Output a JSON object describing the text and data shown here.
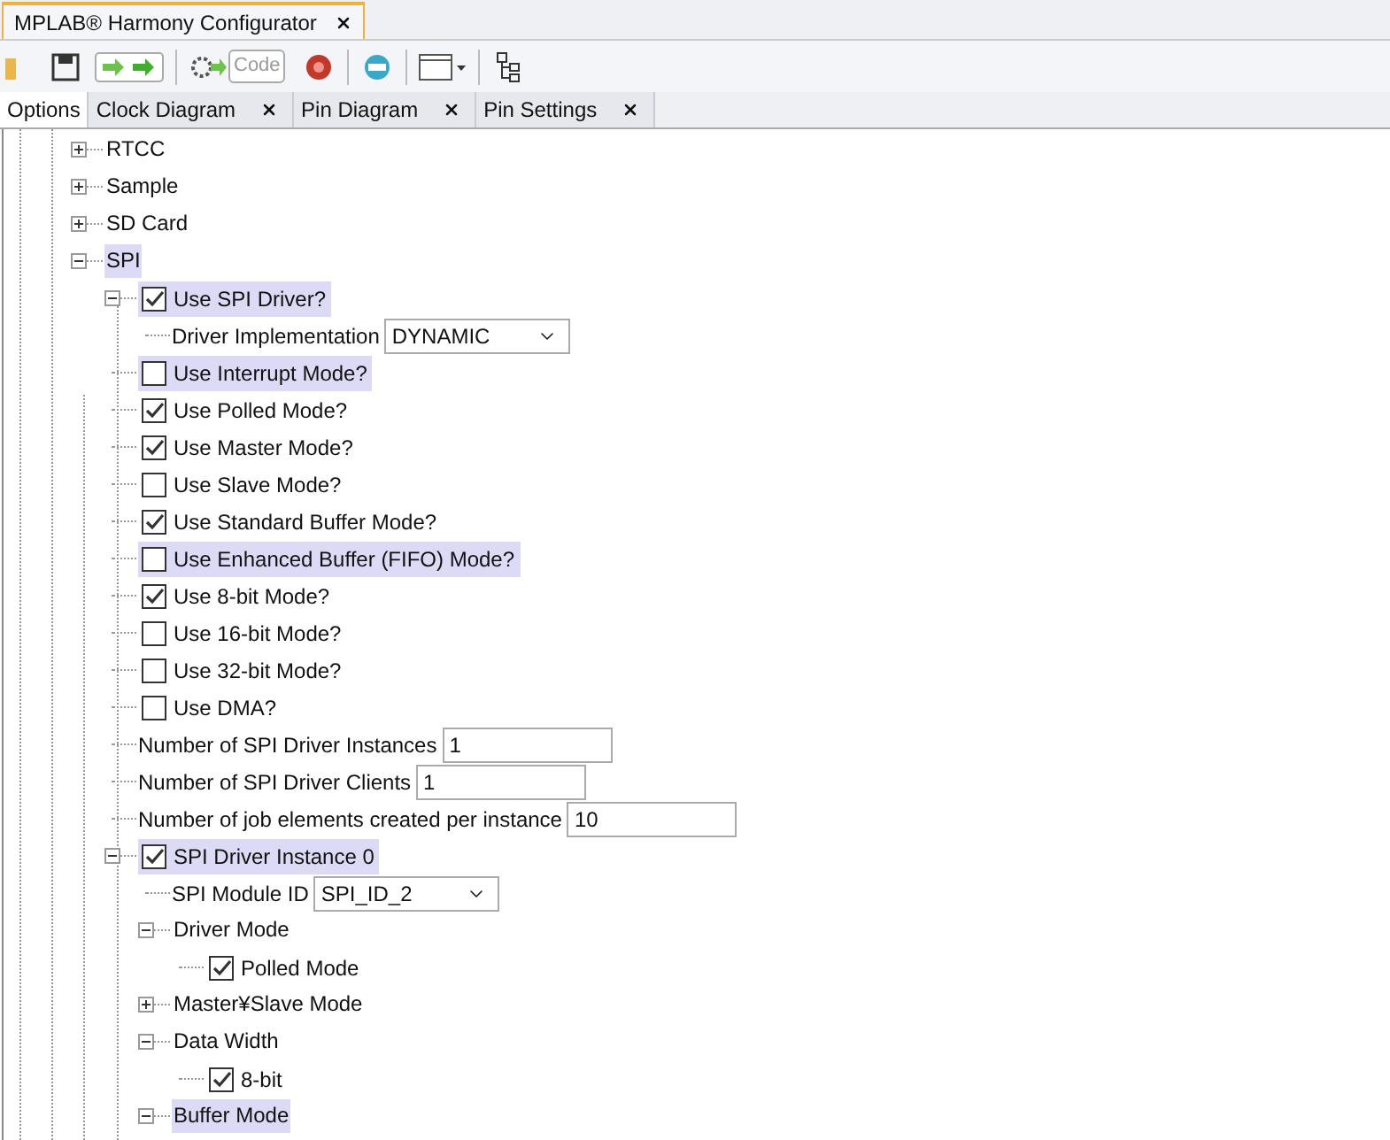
{
  "window": {
    "title": "MPLAB® Harmony Configurator"
  },
  "toolbar": {
    "code_button": "Code"
  },
  "tabs": [
    {
      "label": "Options",
      "selected": true,
      "closable": false
    },
    {
      "label": "Clock Diagram",
      "selected": false,
      "closable": true
    },
    {
      "label": "Pin Diagram",
      "selected": false,
      "closable": true
    },
    {
      "label": "Pin Settings",
      "selected": false,
      "closable": true
    }
  ],
  "tree": [
    {
      "kind": "node",
      "label": "RTCC",
      "expanded": false,
      "highlighted": false
    },
    {
      "kind": "node",
      "label": "Sample",
      "expanded": false,
      "highlighted": false
    },
    {
      "kind": "node",
      "label": "SD Card",
      "expanded": false,
      "highlighted": false
    },
    {
      "kind": "node",
      "label": "SPI",
      "expanded": true,
      "highlighted": true,
      "children": [
        {
          "kind": "checkbox",
          "label": "Use SPI Driver?",
          "checked": true,
          "expanded": true,
          "highlighted": true,
          "children": [
            {
              "kind": "combo",
              "label": "Driver Implementation",
              "value": "DYNAMIC"
            }
          ]
        },
        {
          "kind": "checkbox",
          "label": "Use Interrupt Mode?",
          "checked": false,
          "highlighted": true
        },
        {
          "kind": "checkbox",
          "label": "Use Polled Mode?",
          "checked": true,
          "highlighted": false
        },
        {
          "kind": "checkbox",
          "label": "Use Master Mode?",
          "checked": true,
          "highlighted": false
        },
        {
          "kind": "checkbox",
          "label": "Use Slave Mode?",
          "checked": false,
          "highlighted": false
        },
        {
          "kind": "checkbox",
          "label": "Use Standard Buffer Mode?",
          "checked": true,
          "highlighted": false
        },
        {
          "kind": "checkbox",
          "label": "Use Enhanced Buffer (FIFO) Mode?",
          "checked": false,
          "highlighted": true
        },
        {
          "kind": "checkbox",
          "label": "Use 8-bit Mode?",
          "checked": true,
          "highlighted": false
        },
        {
          "kind": "checkbox",
          "label": "Use 16-bit Mode?",
          "checked": false,
          "highlighted": false
        },
        {
          "kind": "checkbox",
          "label": "Use 32-bit Mode?",
          "checked": false,
          "highlighted": false
        },
        {
          "kind": "checkbox",
          "label": "Use DMA?",
          "checked": false,
          "highlighted": false
        },
        {
          "kind": "field",
          "label": "Number of SPI Driver Instances",
          "value": "1"
        },
        {
          "kind": "field",
          "label": "Number of SPI Driver Clients",
          "value": "1"
        },
        {
          "kind": "field",
          "label": "Number of job elements created per instance",
          "value": "10"
        },
        {
          "kind": "checkbox",
          "label": "SPI Driver Instance 0",
          "checked": true,
          "expanded": true,
          "highlighted": true,
          "children": [
            {
              "kind": "combo",
              "label": "SPI Module ID",
              "value": "SPI_ID_2"
            },
            {
              "kind": "node",
              "label": "Driver Mode",
              "expanded": true,
              "highlighted": false,
              "children": [
                {
                  "kind": "checkbox",
                  "label": "Polled Mode",
                  "checked": true,
                  "highlighted": false
                }
              ]
            },
            {
              "kind": "node",
              "label": "Master¥Slave Mode",
              "expanded": false,
              "highlighted": false
            },
            {
              "kind": "node",
              "label": "Data Width",
              "expanded": true,
              "highlighted": false,
              "children": [
                {
                  "kind": "checkbox",
                  "label": "8-bit",
                  "checked": true,
                  "highlighted": false
                }
              ]
            },
            {
              "kind": "node",
              "label": "Buffer Mode",
              "expanded": true,
              "highlighted": true
            }
          ]
        }
      ]
    }
  ]
}
